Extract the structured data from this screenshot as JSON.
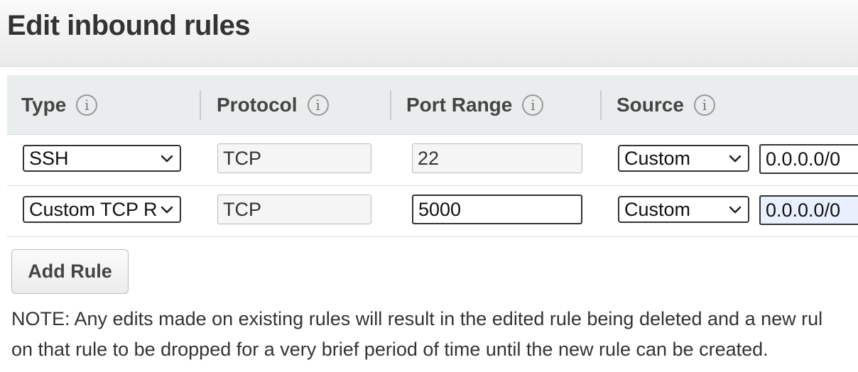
{
  "header": {
    "title": "Edit inbound rules"
  },
  "table": {
    "columns": [
      {
        "label": "Type"
      },
      {
        "label": "Protocol"
      },
      {
        "label": "Port Range"
      },
      {
        "label": "Source"
      }
    ],
    "info_glyph": "i",
    "rows": [
      {
        "type": "SSH",
        "protocol": "TCP",
        "port_range": "22",
        "source_mode": "Custom",
        "source_value": "0.0.0.0/0"
      },
      {
        "type": "Custom TCP Rule",
        "protocol": "TCP",
        "port_range": "5000",
        "source_mode": "Custom",
        "source_value": "0.0.0.0/0"
      }
    ]
  },
  "actions": {
    "add_rule_label": "Add Rule"
  },
  "note": {
    "line1": "NOTE: Any edits made on existing rules will result in the edited rule being deleted and a new rul",
    "line2": "on that rule to be dropped for a very brief period of time until the new rule can be created."
  },
  "icons": {
    "info": "info-circle-icon",
    "chevron": "chevron-down-icon"
  }
}
